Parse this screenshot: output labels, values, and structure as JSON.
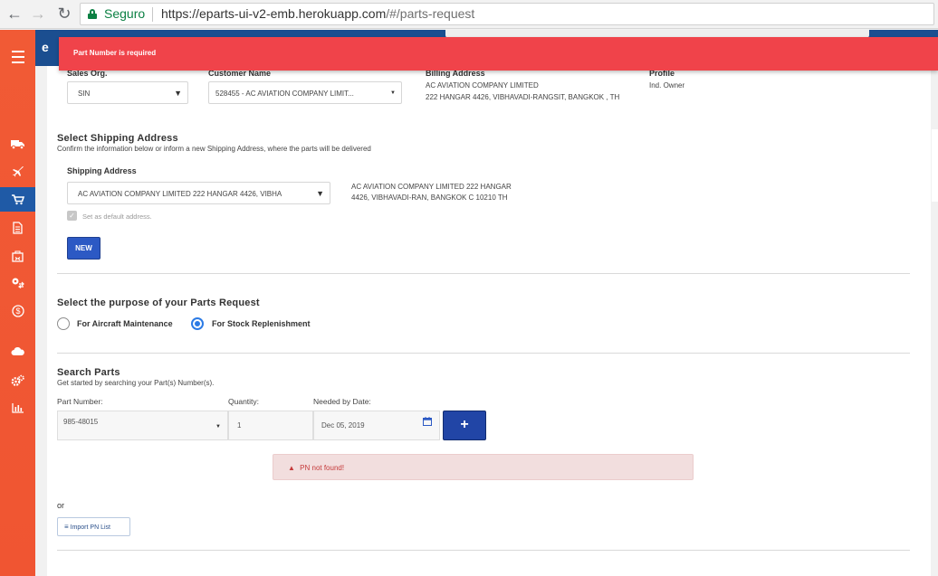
{
  "browser": {
    "secure_label": "Seguro",
    "url_base": "https://eparts-ui-v2-emb.herokuapp.com",
    "url_path": "/#/parts-request"
  },
  "app": {
    "brand_letter": "e"
  },
  "toast": {
    "message": "Part Number is required"
  },
  "customer": {
    "sales_org_label": "Sales Org.",
    "sales_org_value": "SIN",
    "customer_name_label": "Customer Name",
    "customer_name_value": "528455 - AC AVIATION COMPANY LIMIT...",
    "billing_label": "Billing Address",
    "billing_line1": "AC AVIATION COMPANY LIMITED",
    "billing_line2": "222 HANGAR 4426, VIBHAVADI-RANGSIT, BANGKOK , TH",
    "profile_label": "Profile",
    "profile_value": "Ind. Owner"
  },
  "shipping": {
    "title": "Select Shipping Address",
    "subtitle": "Confirm the information below or inform a new Shipping Address, where the parts will be delivered",
    "field_label": "Shipping Address",
    "selected": "AC AVIATION COMPANY LIMITED 222 HANGAR 4426, VIBHA",
    "address_line1": "AC AVIATION COMPANY LIMITED 222 HANGAR",
    "address_line2": "4426, VIBHAVADI-RAN, BANGKOK C 10210 TH",
    "default_label": "Set as default address.",
    "default_checked": true,
    "new_button": "NEW"
  },
  "purpose": {
    "title": "Select the purpose of your Parts Request",
    "option1": "For Aircraft Maintenance",
    "option2": "For Stock Replenishment",
    "selected": "For Stock Replenishment"
  },
  "search": {
    "title": "Search Parts",
    "subtitle": "Get started by searching your Part(s) Number(s).",
    "part_label": "Part Number:",
    "part_value": "985-48015",
    "qty_label": "Quantity:",
    "qty_value": "1",
    "date_label": "Needed by Date:",
    "date_value": "Dec 05, 2019",
    "add_button": "+",
    "alert": "PN not found!",
    "or_label": "or",
    "import_button": "Import PN List"
  },
  "colors": {
    "sidebar": "#f15a35",
    "appbar": "#1b4e90",
    "toast": "#f0434a",
    "primary_button": "#2145a6",
    "alert_bg": "#f2dede"
  }
}
